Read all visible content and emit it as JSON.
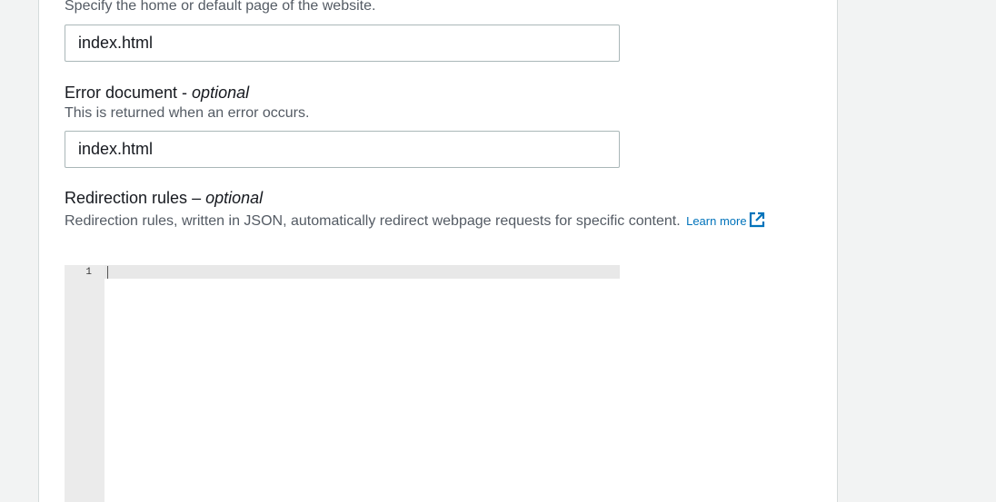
{
  "index_document": {
    "description": "Specify the home or default page of the website.",
    "value": "index.html"
  },
  "error_document": {
    "label": "Error document - ",
    "optional": "optional",
    "description": "This is returned when an error occurs.",
    "value": "index.html"
  },
  "redirection_rules": {
    "label": "Redirection rules – ",
    "optional": "optional",
    "description": "Redirection rules, written in JSON, automatically redirect webpage requests for specific content.",
    "learn_more": "Learn more",
    "link_icon": "external-link-icon",
    "link_color": "#0073bb",
    "editor": {
      "line_numbers": [
        "1"
      ]
    }
  }
}
